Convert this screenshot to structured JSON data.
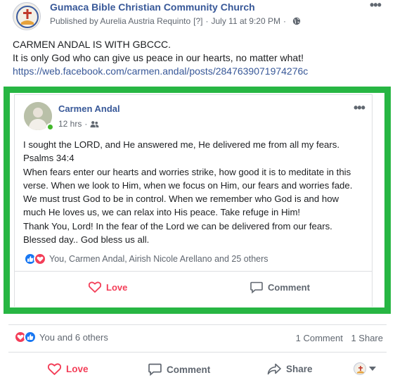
{
  "post": {
    "page_name": "Gumaca Bible Christian Community Church",
    "published_by": "Published by Aurelia Austria Requinto",
    "help_marker": "[?]",
    "date": "July 11 at 9:20 PM",
    "text_lines": [
      "CARMEN ANDAL IS WITH GBCCC.",
      "It is only God who can give us peace in our hearts, no matter what!"
    ],
    "link": "https://web.facebook.com/carmen.andal/posts/2847639071974276c"
  },
  "shared_post": {
    "author": "Carmen Andal",
    "time": "12 hrs",
    "text_lines": [
      "I sought the LORD, and He answered me, He delivered me from all my fears.",
      "Psalms 34:4",
      "When fears enter our hearts and worries strike, how good it is to meditate in this",
      "verse. When we look to Him, when we focus on Him, our fears and worries fade.",
      "We must trust God to be in control. When we remember who God is and how",
      "much He loves us, we can relax into His peace. Take refuge in Him!",
      "Thank You, Lord! In the fear of the Lord we can be delivered from our fears.",
      "Blessed day.. God bless us all."
    ],
    "reactions_text": "You, Carmen Andal, Airish Nicole Arellano and 25 others",
    "love_label": "Love",
    "comment_label": "Comment"
  },
  "footer": {
    "reactions_text": "You and 6 others",
    "comments_count": "1 Comment",
    "shares_count": "1 Share",
    "love_label": "Love",
    "comment_label": "Comment",
    "share_label": "Share"
  },
  "colors": {
    "link_blue": "#385898",
    "highlight_green": "#27b643",
    "love_red": "#f33e58",
    "like_blue": "#1877f2"
  },
  "icons": {
    "more": "more-options-icon",
    "globe": "globe-icon",
    "friends": "friends-icon",
    "like": "like-icon",
    "love": "love-icon",
    "comment": "comment-icon",
    "share": "share-icon"
  }
}
